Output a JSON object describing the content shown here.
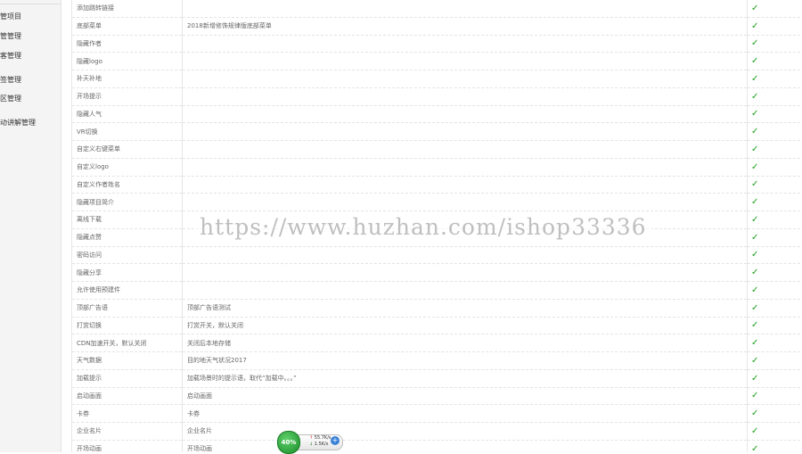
{
  "sidebar": {
    "items": [
      {
        "label": "管项目"
      },
      {
        "label": "管管理"
      },
      {
        "label": "客管理"
      },
      {
        "label": "签管理"
      },
      {
        "label": "区管理"
      },
      {
        "label": "动讲解管理"
      }
    ]
  },
  "table": {
    "rows": [
      {
        "name": "添加跳转链接",
        "value": "",
        "check": "✓"
      },
      {
        "name": "底部菜单",
        "value": "2018新增修饰规律版底部菜单",
        "check": "✓"
      },
      {
        "name": "隐藏作者",
        "value": "",
        "check": "✓"
      },
      {
        "name": "隐藏logo",
        "value": "",
        "check": "✓"
      },
      {
        "name": "补天补地",
        "value": "",
        "check": "✓"
      },
      {
        "name": "开场提示",
        "value": "",
        "check": "✓"
      },
      {
        "name": "隐藏人气",
        "value": "",
        "check": "✓"
      },
      {
        "name": "VR切换",
        "value": "",
        "check": "✓"
      },
      {
        "name": "自定义右键菜单",
        "value": "",
        "check": "✓"
      },
      {
        "name": "自定义logo",
        "value": "",
        "check": "✓"
      },
      {
        "name": "自定义作者姓名",
        "value": "",
        "check": "✓"
      },
      {
        "name": "隐藏项目简介",
        "value": "",
        "check": "✓"
      },
      {
        "name": "离线下载",
        "value": "",
        "check": "✓"
      },
      {
        "name": "隐藏点赞",
        "value": "",
        "check": "✓"
      },
      {
        "name": "密码访问",
        "value": "",
        "check": "✓"
      },
      {
        "name": "隐藏分享",
        "value": "",
        "check": "✓"
      },
      {
        "name": "允许使用预建件",
        "value": "",
        "check": "✓"
      },
      {
        "name": "顶部广告语",
        "value": "顶部广告语测试",
        "check": "✓"
      },
      {
        "name": "打赏切换",
        "value": "打赏开关，默认关闭",
        "check": "✓"
      },
      {
        "name": "CDN加速开关，默认关闭",
        "value": "关闭后本地存储",
        "check": "✓"
      },
      {
        "name": "天气数据",
        "value": "目的地天气状况2017",
        "check": "✓"
      },
      {
        "name": "加载提示",
        "value": "加载场景时的提示语，取代“加载中。。。”",
        "check": "✓"
      },
      {
        "name": "启动画面",
        "value": "启动画面",
        "check": "✓"
      },
      {
        "name": "卡券",
        "value": "卡券",
        "check": "✓"
      },
      {
        "name": "企业名片",
        "value": "企业名片",
        "check": "✓"
      },
      {
        "name": "开场动画",
        "value": "开场动画",
        "check": "✓"
      }
    ]
  },
  "watermark": "https://www.huzhan.com/ishop33336",
  "speed_widget": {
    "percent": "40%",
    "upload": "55.7K/s",
    "download": "1.5K/s",
    "plus": "+"
  },
  "colors": {
    "check": "#1a9e1a",
    "border": "#e3e3e3",
    "sidebar_bg": "#f4f4f4"
  }
}
